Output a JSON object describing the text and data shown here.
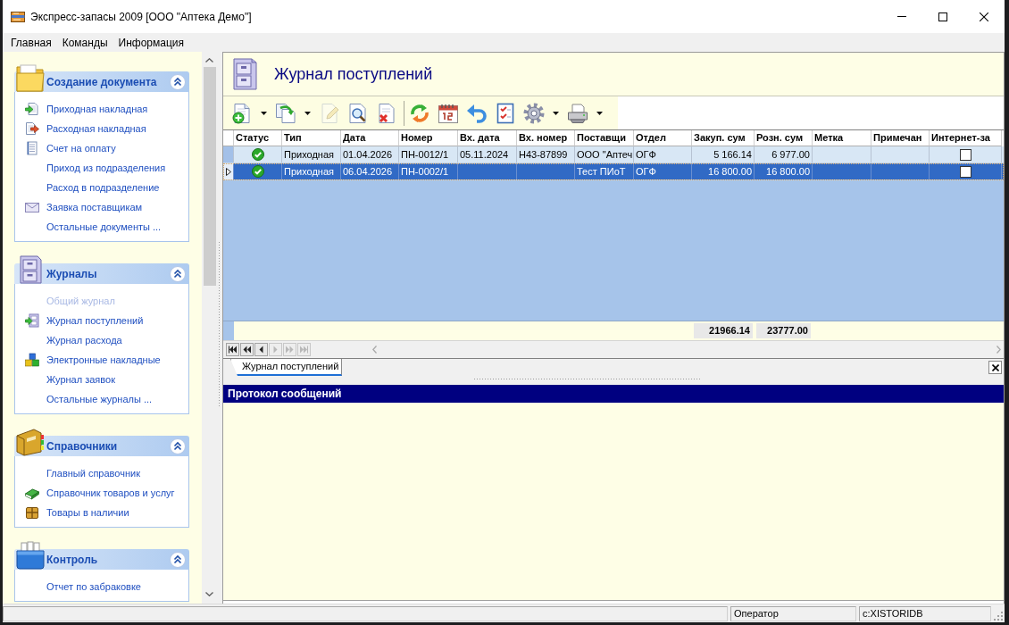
{
  "window": {
    "title": "Экспресс-запасы 2009 [ООО \"Аптека Демо\"]"
  },
  "menu": [
    {
      "label": "Главная"
    },
    {
      "label": "Команды"
    },
    {
      "label": "Информация"
    }
  ],
  "sidebar": {
    "groups": [
      {
        "kind": "folder",
        "title": "Создание документа",
        "expanded": true,
        "items": [
          {
            "kind": "incoming",
            "label": "Приходная накладная",
            "disabled": false
          },
          {
            "kind": "outgoing",
            "label": "Расходная накладная",
            "disabled": false
          },
          {
            "kind": "invoice",
            "label": "Счет на оплату",
            "disabled": false
          },
          {
            "kind": "plain",
            "label": "Приход из подразделения",
            "disabled": false
          },
          {
            "kind": "plain",
            "label": "Расход в подразделение",
            "disabled": false
          },
          {
            "kind": "mail",
            "label": "Заявка поставщикам",
            "disabled": false
          },
          {
            "kind": "plain",
            "label": "Остальные документы ...",
            "disabled": false
          }
        ]
      },
      {
        "kind": "cabinet",
        "title": "Журналы",
        "expanded": true,
        "items": [
          {
            "kind": "plain",
            "label": "Общий журнал",
            "disabled": true
          },
          {
            "kind": "journal",
            "label": "Журнал поступлений",
            "disabled": false
          },
          {
            "kind": "plain",
            "label": "Журнал расхода",
            "disabled": false
          },
          {
            "kind": "cubes",
            "label": "Электронные накладные",
            "disabled": false
          },
          {
            "kind": "plain",
            "label": "Журнал заявок",
            "disabled": false
          },
          {
            "kind": "plain",
            "label": "Остальные журналы ...",
            "disabled": false
          }
        ]
      },
      {
        "kind": "book",
        "title": "Справочники",
        "expanded": true,
        "items": [
          {
            "kind": "plain",
            "label": "Главный справочник",
            "disabled": false
          },
          {
            "kind": "greenbook",
            "label": "Справочник товаров и услуг",
            "disabled": false
          },
          {
            "kind": "parcel",
            "label": "Товары в наличии",
            "disabled": false
          }
        ]
      },
      {
        "kind": "tray",
        "title": "Контроль",
        "expanded": true,
        "items": [
          {
            "kind": "plain",
            "label": "Отчет по забраковке",
            "disabled": false
          }
        ]
      }
    ]
  },
  "journal": {
    "title": "Журнал поступлений"
  },
  "toolbar": {
    "items": [
      {
        "kind": "new",
        "disabled": false
      },
      {
        "kind": "menu_arrow",
        "disabled": false
      },
      {
        "kind": "copy",
        "disabled": false
      },
      {
        "kind": "menu_arrow",
        "disabled": false
      },
      {
        "kind": "edit",
        "disabled": true
      },
      {
        "kind": "view",
        "disabled": false
      },
      {
        "kind": "delete",
        "disabled": false
      },
      {
        "kind": "separator"
      },
      {
        "kind": "refresh",
        "disabled": false
      },
      {
        "kind": "calendar",
        "disabled": false
      },
      {
        "kind": "undo",
        "disabled": false
      },
      {
        "kind": "checklist",
        "disabled": false
      },
      {
        "kind": "settings",
        "disabled": false
      },
      {
        "kind": "menu_arrow",
        "disabled": false
      },
      {
        "kind": "print",
        "disabled": false
      },
      {
        "kind": "menu_arrow",
        "disabled": false
      }
    ]
  },
  "table": {
    "columns": [
      {
        "label": "Статус",
        "kind": "status"
      },
      {
        "label": "Тип",
        "kind": "text"
      },
      {
        "label": "Дата",
        "kind": "text"
      },
      {
        "label": "Номер",
        "kind": "text"
      },
      {
        "label": "Вх. дата",
        "kind": "text"
      },
      {
        "label": "Вх. номер",
        "kind": "text"
      },
      {
        "label": "Поставщи",
        "kind": "text"
      },
      {
        "label": "Отдел",
        "kind": "text"
      },
      {
        "label": "Закуп. сум",
        "kind": "number"
      },
      {
        "label": "Розн. сум",
        "kind": "number"
      },
      {
        "label": "Метка",
        "kind": "text"
      },
      {
        "label": "Примечан",
        "kind": "text"
      },
      {
        "label": "Интернет-за",
        "kind": "check"
      }
    ],
    "rows": [
      {
        "selected": false,
        "done": true,
        "type": "Приходная",
        "date": "01.04.2026",
        "number": "ПН-0012/1",
        "in_date": "05.11.2024",
        "in_number": "Н43-87899",
        "supplier": "ООО \"Аптеч",
        "department": "ОГФ",
        "purchase_sum": "5 166.14",
        "retail_sum": "6 977.00",
        "internet_order": false
      },
      {
        "selected": true,
        "done": true,
        "type": "Приходная",
        "date": "06.04.2026",
        "number": "ПН-0002/1",
        "supplier": "Тест ПИоТ",
        "department": "ОГФ",
        "purchase_sum": "16 800.00",
        "retail_sum": "16 800.00",
        "internet_order": false
      }
    ],
    "totals": {
      "purchase_sum": "21966.14",
      "retail_sum": "23777.00"
    }
  },
  "navigator": {
    "buttons": [
      {
        "kind": "first",
        "disabled": false
      },
      {
        "kind": "prev_page",
        "disabled": false
      },
      {
        "kind": "prev",
        "disabled": false
      },
      {
        "kind": "next",
        "disabled": true
      },
      {
        "kind": "next_page",
        "disabled": true
      },
      {
        "kind": "last",
        "disabled": true
      }
    ]
  },
  "tabs": [
    {
      "label": "Журнал поступлений",
      "selected": true
    }
  ],
  "messages": {
    "title": "Протокол сообщений"
  },
  "status_bar": {
    "panels": [
      "Оператор",
      "c:XISTORIDB"
    ]
  }
}
